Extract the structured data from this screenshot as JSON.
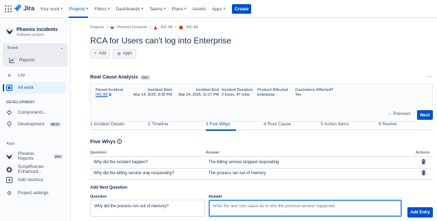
{
  "app": {
    "name": "Jira",
    "logo_icon": "jira-logo-icon",
    "brand_color": "#0052cc"
  },
  "topnav": {
    "items": [
      {
        "label": "Your work",
        "caret": true,
        "active": false
      },
      {
        "label": "Projects",
        "caret": true,
        "active": true
      },
      {
        "label": "Filters",
        "caret": true,
        "active": false
      },
      {
        "label": "Dashboards",
        "caret": true,
        "active": false
      },
      {
        "label": "Teams",
        "caret": true,
        "active": false
      },
      {
        "label": "Plans",
        "caret": true,
        "active": false
      },
      {
        "label": "Assets",
        "caret": false,
        "active": false
      },
      {
        "label": "Apps",
        "caret": true,
        "active": false
      }
    ],
    "create_label": "Create"
  },
  "sidebar": {
    "project_name": "Phoenix Incidents",
    "project_type": "Software project",
    "board_label": "Board",
    "board_reports": "Reports",
    "list": "List",
    "all_work": "All work",
    "development_heading": "DEVELOPMENT",
    "components": "Components...",
    "development": "Development",
    "beta_badge": "BETA",
    "apps_heading": "Apps",
    "phoenix_reports": "Phoenix Reports",
    "dev_badge": "DEV",
    "scriptrunner": "ScriptRunner Enhanced...",
    "add_shortcut": "Add shortcut",
    "project_settings": "Project settings"
  },
  "breadcrumb": {
    "projects": "Projects",
    "sep": "/",
    "project": "Phoenix Incidents",
    "parent_key": "INC-88",
    "issue_key": "INC-89"
  },
  "issue": {
    "title": "RCA for Users can't log into Enterprise",
    "add_label": "Add",
    "apps_label": "Apps"
  },
  "rca": {
    "heading": "Root Cause Analysis",
    "dev_badge": "DEV",
    "more": "···",
    "fields": {
      "parent_label": "Parent Incident",
      "parent_value": "INC-88",
      "start_label": "Incident Start",
      "start_value": "Mar 14, 2025, 8:30 PM",
      "end_label": "Incident End",
      "end_value": "Mar 14, 2025, 11:17 PM",
      "duration_label": "Incident Duration",
      "duration_value": "2 hours, 47 mins",
      "product_label": "Product Affected",
      "product_value": "Enterprise",
      "customers_label": "Customers Affected?",
      "customers_value": "Yes"
    },
    "previous_label": "Previous",
    "next_label": "Next",
    "tabs": [
      "1 Incident Details",
      "2 Timeline",
      "3 Five Whys",
      "4 Root Cause",
      "5 Action Items",
      "6 Review"
    ],
    "active_tab": 2
  },
  "five_whys": {
    "title": "Five Whys",
    "col_question": "Question",
    "col_answer": "Answer",
    "col_actions": "Actions",
    "rows": [
      {
        "question": "Why did the incident happen?",
        "answer": "The billing service stopped responding"
      },
      {
        "question": "Why did the billing service stop responding?",
        "answer": "The process ran out of memory"
      }
    ],
    "add_heading": "Add Next Question",
    "question_label": "Question",
    "answer_label": "Answer",
    "question_value": "Why did the process run out of memory?",
    "answer_placeholder": "Write the next root cause as to why the previous answer happened.",
    "add_entry_label": "Add Entry"
  }
}
